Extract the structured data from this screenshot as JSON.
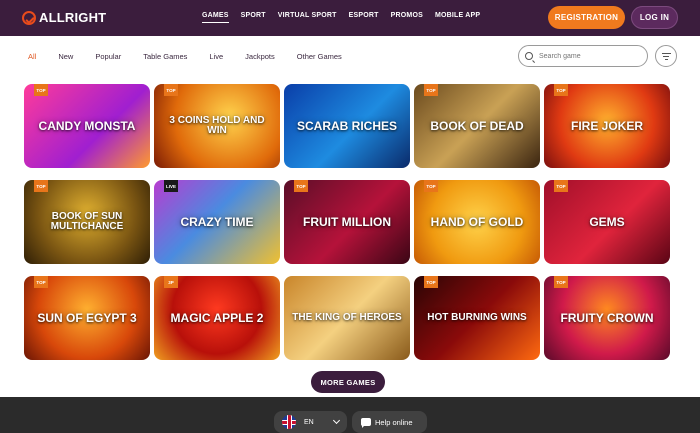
{
  "header": {
    "logo": "ALLRIGHT",
    "nav": [
      "GAMES",
      "SPORT",
      "VIRTUAL SPORT",
      "ESPORT",
      "PROMOS",
      "MOBILE APP"
    ],
    "registration_label": "REGISTRATION",
    "login_label": "LOG IN"
  },
  "filters": [
    "All",
    "New",
    "Popular",
    "Table Games",
    "Live",
    "Jackpots",
    "Other Games"
  ],
  "search": {
    "placeholder": "Search game"
  },
  "games": [
    {
      "title": "Candy Monsta",
      "badge": "TOP",
      "bg": "linear-gradient(135deg,#ff3b9a,#a01fd0 60%,#ff9a2e)"
    },
    {
      "title": "3 Coins Hold and Win",
      "badge": "TOP",
      "bg": "radial-gradient(circle at 60% 40%,#ffd34d,#e06a0a 60%,#7a1b05)"
    },
    {
      "title": "Scarab Riches",
      "badge": "",
      "bg": "linear-gradient(135deg,#0a3ea8,#1e8be0 55%,#0a2a6a)"
    },
    {
      "title": "Book of Dead",
      "badge": "TOP",
      "bg": "linear-gradient(135deg,#6b4a1e,#c9a155 50%,#3a2410)"
    },
    {
      "title": "Fire Joker",
      "badge": "TOP",
      "bg": "radial-gradient(circle at 50% 45%,#ffb02e,#e03a12 60%,#7a0f0f)"
    },
    {
      "title": "Book of Sun Multichance",
      "badge": "TOP",
      "bg": "radial-gradient(circle at 50% 40%,#e0b030,#7a5512 60%,#2e1e06)"
    },
    {
      "title": "Crazy Time",
      "badge": "LIVE",
      "bg": "linear-gradient(135deg,#b83cd0,#4a8be0 45%,#f0c030)"
    },
    {
      "title": "Fruit Million",
      "badge": "TOP",
      "bg": "linear-gradient(135deg,#5a0e28,#b5123a 55%,#3a0615)"
    },
    {
      "title": "Hand of Gold",
      "badge": "TOP",
      "bg": "radial-gradient(circle at 50% 50%,#ffd24a,#f09a10 60%,#c65a05)"
    },
    {
      "title": "Gems",
      "badge": "TOP",
      "bg": "linear-gradient(135deg,#a00f2a,#e0243c 55%,#5a0515)"
    },
    {
      "title": "Sun of Egypt 3",
      "badge": "TOP",
      "bg": "radial-gradient(circle at 50% 40%,#ffb030,#d8480a 60%,#6a1505)"
    },
    {
      "title": "Magic Apple 2",
      "badge": "3P",
      "bg": "radial-gradient(circle at 50% 40%,#ff3a20,#b8100a 55%,#f0a020)"
    },
    {
      "title": "The King of Heroes",
      "badge": "",
      "bg": "linear-gradient(135deg,#c9852a,#f4d080 50%,#8a5a1a)"
    },
    {
      "title": "Hot Burning Wins",
      "badge": "TOP",
      "bg": "linear-gradient(135deg,#2a0505,#8a0a0a 50%,#ff6a10)"
    },
    {
      "title": "Fruity Crown",
      "badge": "TOP",
      "bg": "radial-gradient(circle at 50% 40%,#ff8a20,#d01a4a 55%,#5a0a2a)"
    }
  ],
  "more_games_label": "MORE GAMES",
  "footer": {
    "language": "EN",
    "help_label": "Help online"
  },
  "colors": {
    "header_bg": "#3b1d3d",
    "accent": "#f07a1e",
    "active_filter": "#e05a25",
    "footer_bg": "#2b2b2b"
  }
}
